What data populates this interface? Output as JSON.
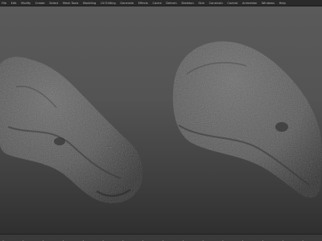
{
  "menubar": {
    "items": [
      "File",
      "Edit",
      "Modify",
      "Create",
      "Select",
      "Mesh Tools",
      "Modeling",
      "UV Editing",
      "Generate",
      "Effects",
      "Cache",
      "Deform",
      "Skeleton",
      "Skin",
      "Constrain",
      "Control",
      "Animation",
      "Windows",
      "Help"
    ]
  },
  "viewport": {
    "background_top": "#5a5a5a",
    "background_bottom": "#2f2f2f",
    "objects": [
      {
        "name": "asteroid-left",
        "color": "#5c5c5c"
      },
      {
        "name": "asteroid-right",
        "color": "#5e5e5e"
      }
    ]
  },
  "timeline": {
    "tick_count": 80,
    "color": "#3a3a3a"
  }
}
